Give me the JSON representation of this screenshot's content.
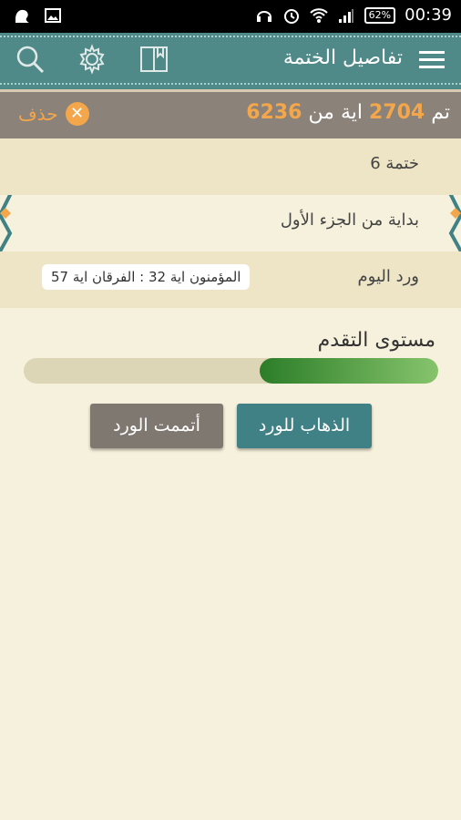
{
  "status_bar": {
    "time": "00:39",
    "battery": "62%"
  },
  "app_bar": {
    "title": "تفاصيل الختمة",
    "icons": [
      "menu-icon",
      "book-icon",
      "settings-icon",
      "search-icon"
    ]
  },
  "info_bar": {
    "prefix": "تم",
    "completed": "2704",
    "middle": "اية من",
    "total": "6236",
    "delete_label": "حذف"
  },
  "details": {
    "khatma_name": "ختمة 6",
    "start": "بداية من الجزء الأول",
    "today_label": "ورد اليوم",
    "today_range": "المؤمنون اية 32 : الفرقان اية 57"
  },
  "progress": {
    "label": "مستوى التقدم",
    "fraction": 0.43
  },
  "buttons": {
    "go": "الذهاب للورد",
    "done": "أتممت الورد"
  },
  "colors": {
    "header": "#4f8a88",
    "accent": "#f4a64a",
    "info_bar": "#8b8279",
    "progress": "#2c7d28"
  }
}
